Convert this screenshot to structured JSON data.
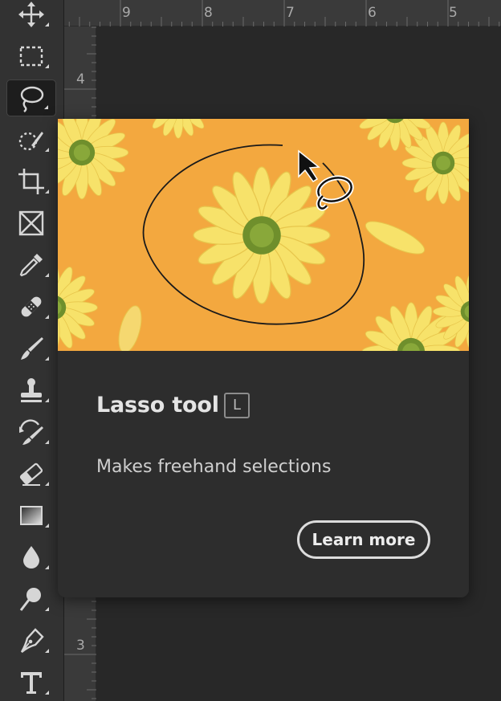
{
  "toolbar": {
    "tools": [
      {
        "name": "move-tool",
        "icon": "move-icon",
        "active": false
      },
      {
        "name": "rectangular-marquee-tool",
        "icon": "marquee-icon",
        "active": false
      },
      {
        "name": "lasso-tool",
        "icon": "lasso-icon",
        "active": true
      },
      {
        "name": "quick-selection-tool",
        "icon": "quick-selection-icon",
        "active": false
      },
      {
        "name": "crop-tool",
        "icon": "crop-icon",
        "active": false
      },
      {
        "name": "frame-tool",
        "icon": "frame-icon",
        "active": false
      },
      {
        "name": "eyedropper-tool",
        "icon": "eyedropper-icon",
        "active": false
      },
      {
        "name": "spot-healing-tool",
        "icon": "bandage-icon",
        "active": false
      },
      {
        "name": "brush-tool",
        "icon": "brush-icon",
        "active": false
      },
      {
        "name": "clone-stamp-tool",
        "icon": "stamp-icon",
        "active": false
      },
      {
        "name": "history-brush-tool",
        "icon": "history-brush-icon",
        "active": false
      },
      {
        "name": "eraser-tool",
        "icon": "eraser-icon",
        "active": false
      },
      {
        "name": "gradient-tool",
        "icon": "gradient-icon",
        "active": false
      },
      {
        "name": "blur-tool",
        "icon": "drop-icon",
        "active": false
      },
      {
        "name": "dodge-tool",
        "icon": "dodge-icon",
        "active": false
      },
      {
        "name": "pen-tool",
        "icon": "pen-icon",
        "active": false
      },
      {
        "name": "type-tool",
        "icon": "type-icon",
        "active": false
      }
    ]
  },
  "rulers": {
    "top": [
      "9",
      "8",
      "7",
      "6",
      "5"
    ],
    "left": [
      "4",
      "3"
    ]
  },
  "tooltip": {
    "image": "lasso-demo-flowers-image",
    "title": "Lasso tool",
    "shortcut": "L",
    "description": "Makes freehand selections",
    "learn_more_label": "Learn more"
  },
  "colors": {
    "toolbar_bg": "#323232",
    "canvas_bg": "#282828",
    "card_bg": "#2d2d2d",
    "image_bg": "#f3a83f",
    "petal": "#f7e26a",
    "flower_center": "#6f8f2c"
  }
}
